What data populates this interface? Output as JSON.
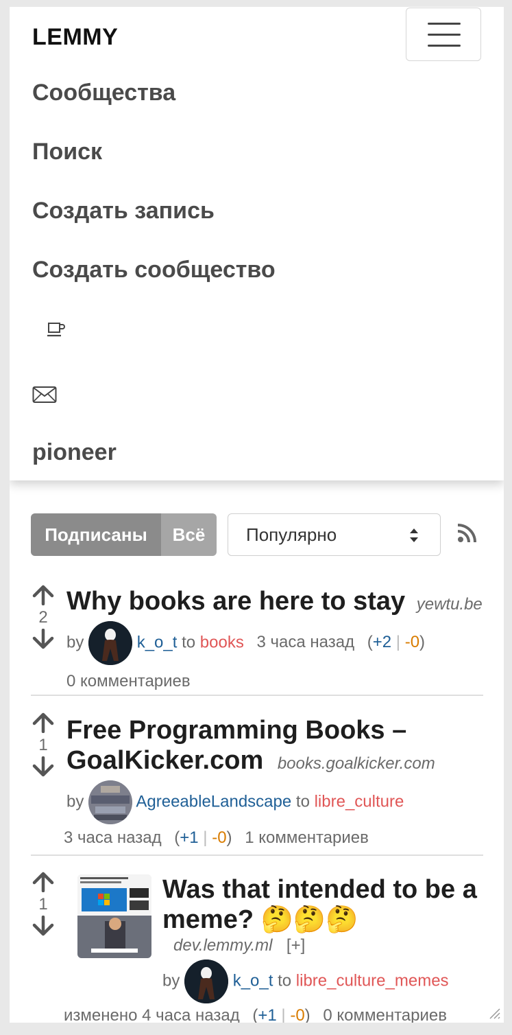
{
  "navbar": {
    "brand": "LEMMY",
    "items": [
      {
        "label": "Сообщества"
      },
      {
        "label": "Поиск"
      },
      {
        "label": "Создать запись"
      },
      {
        "label": "Создать сообщество"
      }
    ],
    "icons": [
      "coffee-icon",
      "mail-icon"
    ],
    "username": "pioneer"
  },
  "filters": {
    "subscribed_label": "Подписаны",
    "all_label": "Всё",
    "sort_value": "Популярно"
  },
  "posts": [
    {
      "score": "2",
      "title": "Why books are here to stay",
      "domain": "yewtu.be",
      "by": "by",
      "author": "k_o_t",
      "to": "to",
      "community": "books",
      "time": "3 часа назад",
      "upvotes": "+2",
      "downvotes": "-0",
      "comments": "0 комментариев"
    },
    {
      "score": "1",
      "title_line1": "Free Programming Books –",
      "title_line2": "GoalKicker.com",
      "domain": "books.goalkicker.com",
      "by": "by",
      "author": "AgreeableLandscape",
      "to": "to",
      "community": "libre_culture",
      "time": "3 часа назад",
      "upvotes": "+1",
      "downvotes": "-0",
      "comments": "1 комментариев"
    },
    {
      "score": "1",
      "title_line1": "Was that intended to be a",
      "title_line2": "meme? 🤔🤔🤔",
      "domain": "dev.lemmy.ml",
      "expand": "[+]",
      "by": "by",
      "author": "k_o_t",
      "to": "to",
      "community": "libre_culture_memes",
      "time": "изменено 4 часа назад",
      "upvotes": "+1",
      "downvotes": "-0",
      "comments": "0 комментариев"
    }
  ],
  "colors": {
    "user": "#1f5f96",
    "community": "#e05656",
    "downvote": "#d97c00",
    "btn_active": "#8b8b8b"
  }
}
